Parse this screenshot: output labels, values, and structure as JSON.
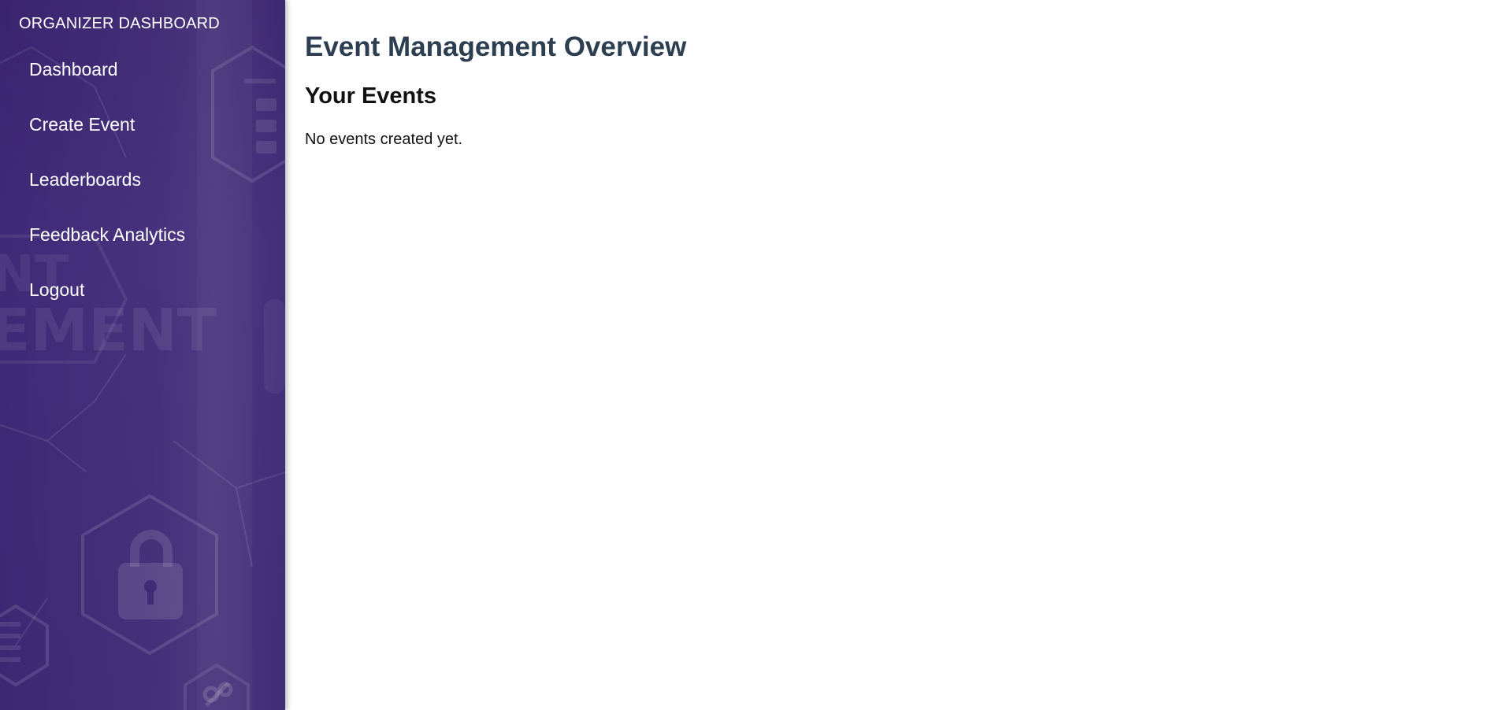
{
  "sidebar": {
    "brand": "ORGANIZER DASHBOARD",
    "items": [
      {
        "label": "Dashboard"
      },
      {
        "label": "Create Event"
      },
      {
        "label": "Leaderboards"
      },
      {
        "label": "Feedback Analytics"
      },
      {
        "label": "Logout"
      }
    ],
    "background_text": "EMENT"
  },
  "main": {
    "title": "Event Management Overview",
    "section_title": "Your Events",
    "empty_message": "No events created yet."
  },
  "colors": {
    "sidebar_bg": "#3d2874",
    "title": "#2c3e50",
    "nav_text": "#ffffff"
  }
}
